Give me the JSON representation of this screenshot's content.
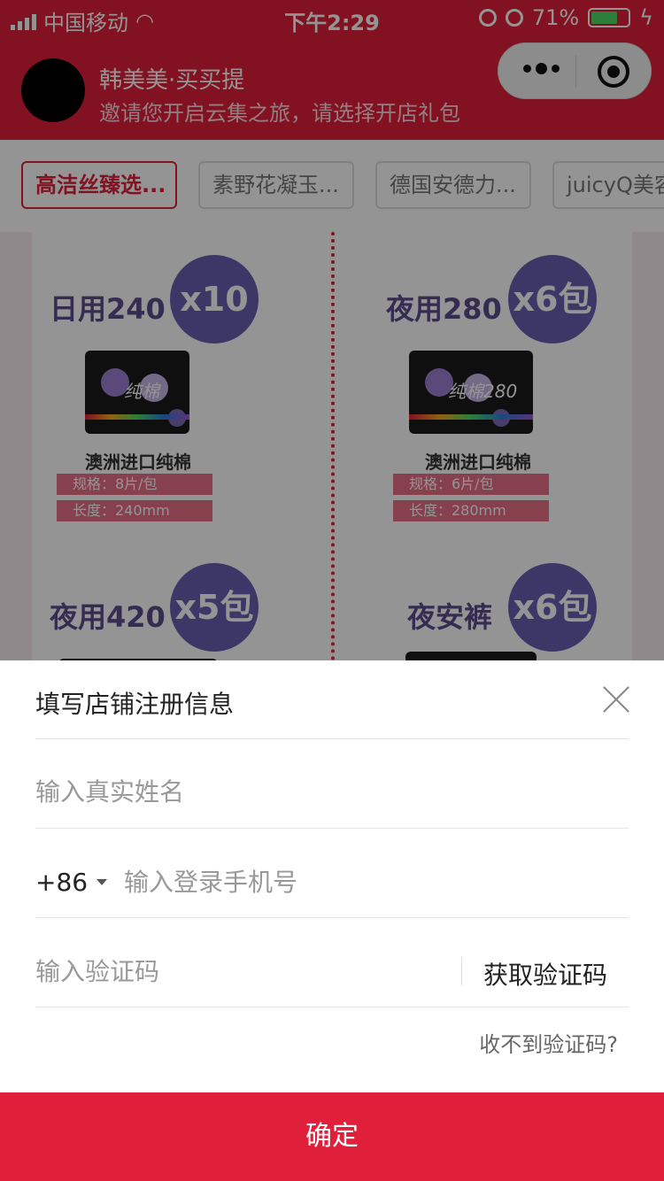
{
  "status_bar": {
    "carrier": "中国移动",
    "time": "下午2:29",
    "battery_pct": "71%",
    "battery_level": 0.71
  },
  "header": {
    "shop_name": "韩美美·买买提",
    "subtitle": "邀请您开启云集之旅，请选择开店礼包"
  },
  "categories": [
    "高洁丝臻选...",
    "素野花凝玉...",
    "德国安德力...",
    "juicyQ美容"
  ],
  "products": [
    {
      "title": "日用240",
      "badge": "x10包",
      "pkg_text": "纯棉",
      "name": "澳洲进口纯棉",
      "spec1": "规格：8片/包",
      "spec2": "长度：240mm"
    },
    {
      "title": "夜用280",
      "badge": "x6包",
      "pkg_text": "纯棉280",
      "name": "澳洲进口纯棉",
      "spec1": "规格：6片/包",
      "spec2": "长度：280mm"
    },
    {
      "title": "夜用420",
      "badge": "x5包"
    },
    {
      "title": "夜安裤",
      "badge": "x6包"
    }
  ],
  "sheet": {
    "title": "填写店铺注册信息",
    "name_placeholder": "输入真实姓名",
    "country_code": "+86",
    "phone_placeholder": "输入登录手机号",
    "code_placeholder": "输入验证码",
    "get_code": "获取验证码",
    "no_code": "收不到验证码?",
    "confirm": "确定"
  }
}
